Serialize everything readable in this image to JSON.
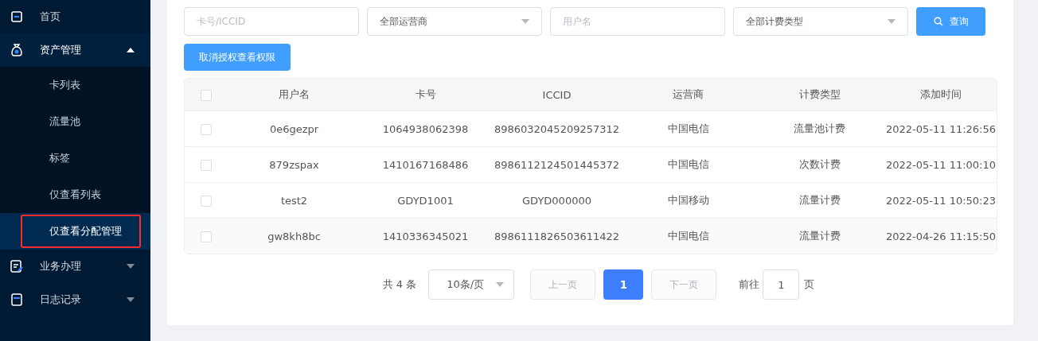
{
  "sidebar": {
    "items": [
      {
        "label": "首页",
        "kind": "link"
      },
      {
        "label": "资产管理",
        "kind": "submenu",
        "expanded": true,
        "children": [
          {
            "label": "卡列表",
            "selected": false
          },
          {
            "label": "流量池",
            "selected": false
          },
          {
            "label": "标签",
            "selected": false
          },
          {
            "label": "仅查看列表",
            "selected": false
          },
          {
            "label": "仅查看分配管理",
            "selected": true
          }
        ]
      },
      {
        "label": "业务办理",
        "kind": "submenu",
        "expanded": false
      },
      {
        "label": "日志记录",
        "kind": "submenu",
        "expanded": false
      }
    ]
  },
  "filters": [
    {
      "kind": "input",
      "placeholder": "卡号/ICCID"
    },
    {
      "kind": "select",
      "value": "全部运营商"
    },
    {
      "kind": "input",
      "placeholder": "用户名"
    },
    {
      "kind": "select",
      "value": "全部计费类型"
    }
  ],
  "search_button": "查询",
  "revoke_button": "取消授权查看权限",
  "table": {
    "header_checked": false,
    "columns": [
      "用户名",
      "卡号",
      "ICCID",
      "运营商",
      "计费类型",
      "添加时间"
    ],
    "rows": [
      {
        "checked": false,
        "cells": [
          "0e6gezpr",
          "1064938062398",
          "8986032045209257312",
          "中国电信",
          "流量池计费",
          "2022-05-11 11:26:56"
        ]
      },
      {
        "checked": false,
        "cells": [
          "879zspax",
          "1410167168486",
          "8986112124501445372",
          "中国电信",
          "次数计费",
          "2022-05-11 11:00:10"
        ]
      },
      {
        "checked": false,
        "cells": [
          "test2",
          "GDYD1001",
          "GDYD000000",
          "中国移动",
          "流量计费",
          "2022-05-11 10:50:23"
        ]
      },
      {
        "checked": false,
        "cells": [
          "gw8kh8bc",
          "1410336345021",
          "8986111826503611422",
          "中国电信",
          "流量计费",
          "2022-04-26 11:15:50"
        ]
      }
    ]
  },
  "pagination": {
    "total": "共 4 条",
    "page_size": "10条/页",
    "prev": {
      "label": "上一页",
      "disabled": true
    },
    "pages": [
      {
        "label": "1",
        "selected": true
      }
    ],
    "next": {
      "label": "下一页",
      "disabled": true
    },
    "goto_label": "前往",
    "goto_value": "1",
    "goto_suffix": "页"
  }
}
